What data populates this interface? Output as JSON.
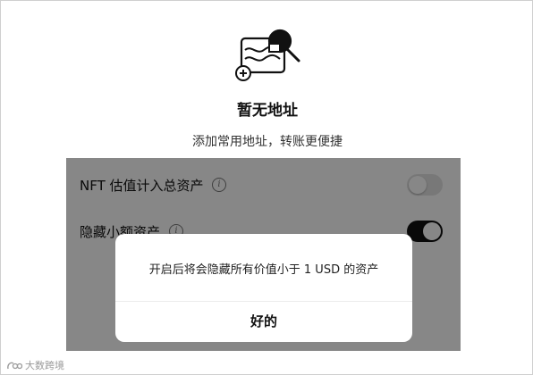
{
  "empty_state": {
    "icon": "address-book-search-icon",
    "title": "暂无地址",
    "subtitle": "添加常用地址，转账更便捷"
  },
  "settings": {
    "items": [
      {
        "label": "NFT 估值计入总资产",
        "info_icon": "info-icon",
        "toggle_on": false
      },
      {
        "label": "隐藏小额资产",
        "info_icon": "info-icon",
        "toggle_on": true
      }
    ]
  },
  "modal": {
    "message": "开启后将会隐藏所有价值小于 1 USD 的资产",
    "confirm_label": "好的"
  },
  "watermark": {
    "text": "大数跨境"
  },
  "colors": {
    "toggle_on": "#111111",
    "toggle_off": "#e3e3e3",
    "overlay": "rgba(0,0,0,0.47)"
  }
}
